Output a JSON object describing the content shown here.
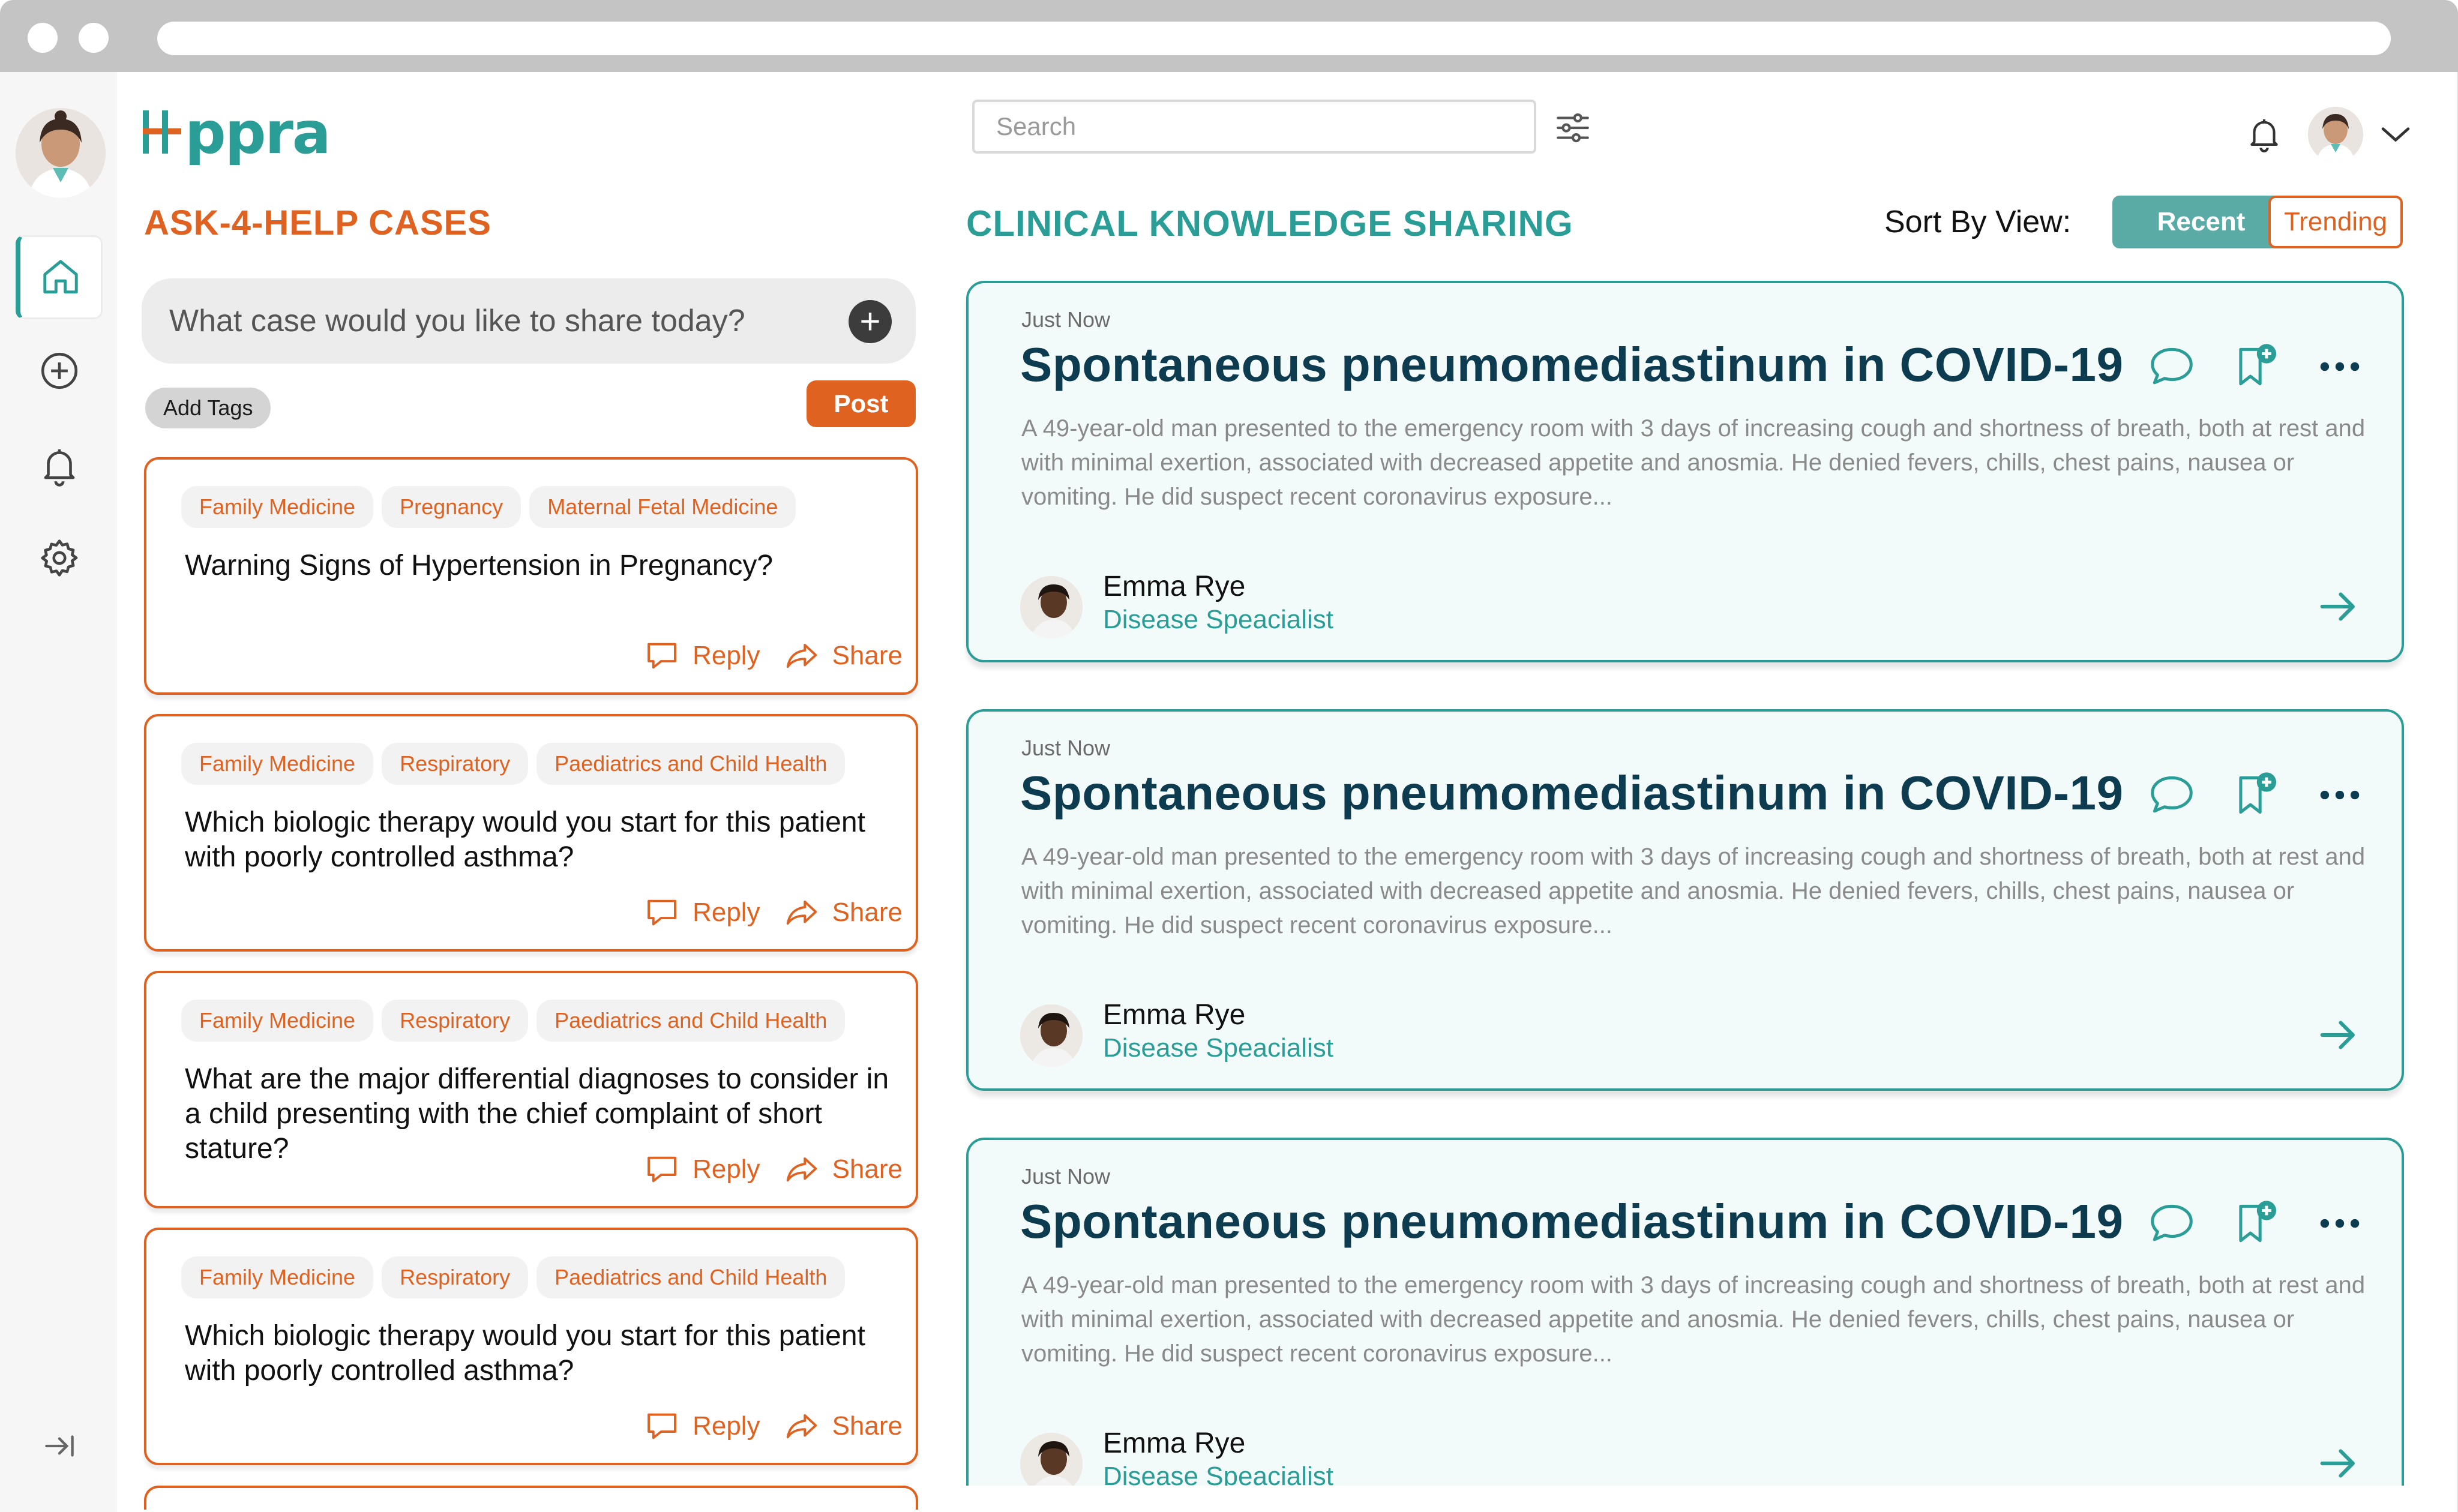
{
  "app": {
    "brand": "ppra",
    "brand_color": "#2a9d96",
    "accent_color": "#e06221"
  },
  "header": {
    "search_placeholder": "Search",
    "icons": [
      "filter-sliders-icon",
      "bell-icon",
      "chevron-down-icon"
    ]
  },
  "rail": {
    "items": [
      {
        "name": "home",
        "icon": "home-icon",
        "active": true
      },
      {
        "name": "add",
        "icon": "plus-circle-icon",
        "active": false
      },
      {
        "name": "notifications",
        "icon": "bell-icon",
        "active": false
      },
      {
        "name": "settings",
        "icon": "gear-icon",
        "active": false
      }
    ],
    "collapse_icon": "collapse-arrow-icon"
  },
  "ask": {
    "title": "ASK-4-HELP CASES",
    "composer_placeholder": "What case would you like to share today?",
    "add_tags_label": "Add Tags",
    "post_label": "Post",
    "reply_label": "Reply",
    "share_label": "Share",
    "cases": [
      {
        "tags": [
          "Family Medicine",
          "Pregnancy",
          "Maternal Fetal Medicine"
        ],
        "title": "Warning Signs of Hypertension in Pregnancy?"
      },
      {
        "tags": [
          "Family Medicine",
          "Respiratory",
          "Paediatrics and Child Health"
        ],
        "title": "Which biologic therapy would you start for this patient with poorly controlled asthma?"
      },
      {
        "tags": [
          "Family Medicine",
          "Respiratory",
          "Paediatrics and Child Health"
        ],
        "title": "What are the major differential diagnoses to consider in a child presenting with the chief complaint of short stature?"
      },
      {
        "tags": [
          "Family Medicine",
          "Respiratory",
          "Paediatrics and Child Health"
        ],
        "title": "Which biologic therapy would you start for this patient with poorly controlled asthma?"
      }
    ]
  },
  "knowledge": {
    "title": "CLINICAL KNOWLEDGE SHARING",
    "sort_label": "Sort By View:",
    "sort_options": [
      "Recent",
      "Trending"
    ],
    "sort_selected": "Recent",
    "posts": [
      {
        "time": "Just Now",
        "title": "Spontaneous pneumomediastinum in COVID-19",
        "body": "A 49-year-old man presented to the emergency room with 3 days of increasing cough and shortness of breath, both at rest and with minimal exertion, associated with decreased appetite and anosmia. He denied fevers, chills, chest pains, nausea or vomiting. He did suspect recent coronavirus exposure...",
        "author": "Emma Rye",
        "role": "Disease Speacialist"
      },
      {
        "time": "Just Now",
        "title": "Spontaneous pneumomediastinum in COVID-19",
        "body": "A 49-year-old man presented to the emergency room with 3 days of increasing cough and shortness of breath, both at rest and with minimal exertion, associated with decreased appetite and anosmia. He denied fevers, chills, chest pains, nausea or vomiting. He did suspect recent coronavirus exposure...",
        "author": "Emma Rye",
        "role": "Disease Speacialist"
      },
      {
        "time": "Just Now",
        "title": "Spontaneous pneumomediastinum in COVID-19",
        "body": "A 49-year-old man presented to the emergency room with 3 days of increasing cough and shortness of breath, both at rest and with minimal exertion, associated with decreased appetite and anosmia. He denied fevers, chills, chest pains, nausea or vomiting. He did suspect recent coronavirus exposure...",
        "author": "Emma Rye",
        "role": "Disease Speacialist"
      }
    ]
  }
}
